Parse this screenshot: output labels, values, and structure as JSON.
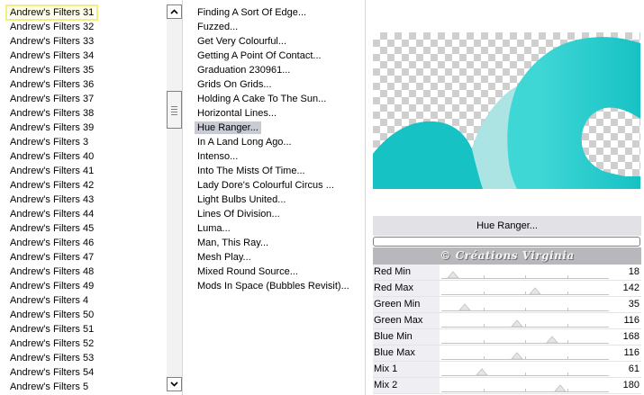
{
  "categories": {
    "items": [
      "Andrew's Filters 31",
      "Andrew's Filters 32",
      "Andrew's Filters 33",
      "Andrew's Filters 34",
      "Andrew's Filters 35",
      "Andrew's Filters 36",
      "Andrew's Filters 37",
      "Andrew's Filters 38",
      "Andrew's Filters 39",
      "Andrew's Filters 3",
      "Andrew's Filters 40",
      "Andrew's Filters 41",
      "Andrew's Filters 42",
      "Andrew's Filters 43",
      "Andrew's Filters 44",
      "Andrew's Filters 45",
      "Andrew's Filters 46",
      "Andrew's Filters 47",
      "Andrew's Filters 48",
      "Andrew's Filters 49",
      "Andrew's Filters 4",
      "Andrew's Filters 50",
      "Andrew's Filters 51",
      "Andrew's Filters 52",
      "Andrew's Filters 53",
      "Andrew's Filters 54",
      "Andrew's Filters 5"
    ],
    "selected_index": 0
  },
  "filters": {
    "items": [
      "Finding A Sort Of Edge...",
      "Fuzzed...",
      "Get Very Colourful...",
      "Getting A Point Of Contact...",
      "Graduation 230961...",
      "Grids On Grids...",
      "Holding A Cake To The Sun...",
      "Horizontal Lines...",
      "Hue Ranger...",
      "In A Land Long Ago...",
      "Intenso...",
      "Into The Mists Of Time...",
      "Lady Dore's Colourful Circus ...",
      "Light Bulbs United...",
      "Lines Of Division...",
      "Luma...",
      "Man, This Ray...",
      "Mesh Play...",
      "Mixed Round Source...",
      "Mods In Space (Bubbles Revisit)..."
    ],
    "selected_index": 8
  },
  "preview": {
    "colors": {
      "wave_dark": "#17c2c4",
      "wave_light": "#3fd6d6",
      "wave_pale": "#bfe6e6",
      "checker": "#cfcfcf"
    }
  },
  "current_filter": "Hue Ranger...",
  "progress": 0,
  "watermark": "© Créations Virginia",
  "params": [
    {
      "label": "Red Min",
      "value": "18",
      "fraction": 0.07
    },
    {
      "label": "Red Max",
      "value": "142",
      "fraction": 0.56
    },
    {
      "label": "Green Min",
      "value": "35",
      "fraction": 0.14
    },
    {
      "label": "Green Max",
      "value": "116",
      "fraction": 0.45
    },
    {
      "label": "Blue Min",
      "value": "168",
      "fraction": 0.66
    },
    {
      "label": "Blue Max",
      "value": "116",
      "fraction": 0.45
    },
    {
      "label": "Mix 1",
      "value": "61",
      "fraction": 0.24
    },
    {
      "label": "Mix 2",
      "value": "180",
      "fraction": 0.71
    }
  ],
  "icons": {
    "scroll_up": "chevron-up-icon",
    "scroll_down": "chevron-down-icon",
    "slider_thumb": "triangle-thumb-icon"
  }
}
